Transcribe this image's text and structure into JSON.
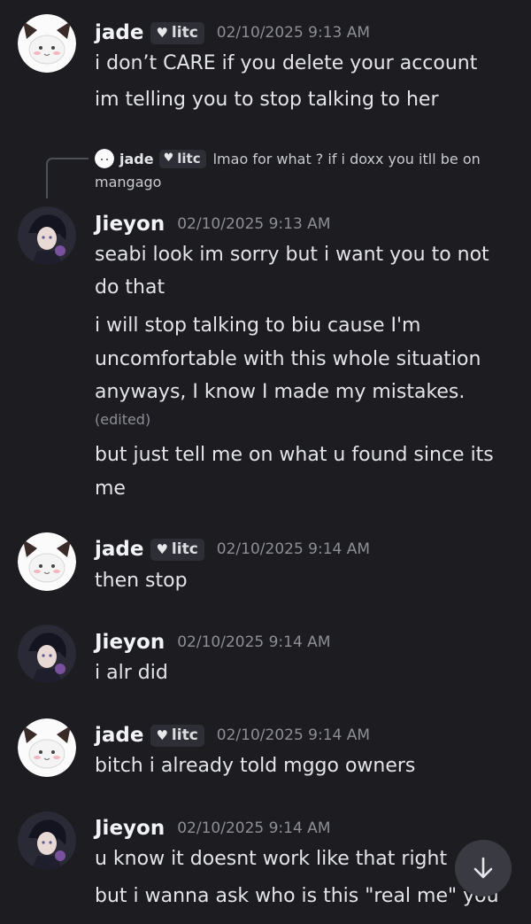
{
  "messages": [
    {
      "author": "jade",
      "tag": "litc",
      "timestamp": "02/10/2025 9:13 AM",
      "lines": [
        "i don’t CARE if you delete your account",
        "im telling you to stop talking to her"
      ]
    },
    {
      "author": "Jieyon",
      "timestamp": "02/10/2025 9:13 AM",
      "reply": {
        "author": "jade",
        "tag": "litc",
        "text": "lmao for what ? if i doxx you itll be on",
        "text_cont": "mangago"
      },
      "lines": [
        "seabi look im sorry but i want you to not",
        "do that",
        "i will stop talking to biu cause I'm",
        "uncomfortable with this whole situation",
        "anyways, I know I made my mistakes.",
        "but just tell me on what u found since its",
        "me"
      ],
      "edited": "(edited)"
    },
    {
      "author": "jade",
      "tag": "litc",
      "timestamp": "02/10/2025 9:14 AM",
      "lines": [
        "then stop"
      ]
    },
    {
      "author": "Jieyon",
      "timestamp": "02/10/2025 9:14 AM",
      "lines": [
        "i alr did"
      ]
    },
    {
      "author": "jade",
      "tag": "litc",
      "timestamp": "02/10/2025 9:14 AM",
      "lines": [
        "bitch i already told mggo owners"
      ]
    },
    {
      "author": "Jieyon",
      "timestamp": "02/10/2025 9:14 AM",
      "lines": [
        "u know it doesnt work like that right",
        "but i wanna ask who is this \"real me\" you"
      ]
    }
  ],
  "icons": {
    "tag_badge": "heart-icon",
    "scroll": "arrow-down-icon"
  },
  "colors": {
    "background": "#1c1c21",
    "text": "#e3e5e8",
    "timestamp": "#8d8f96",
    "tag_bg": "#2e2f36"
  }
}
